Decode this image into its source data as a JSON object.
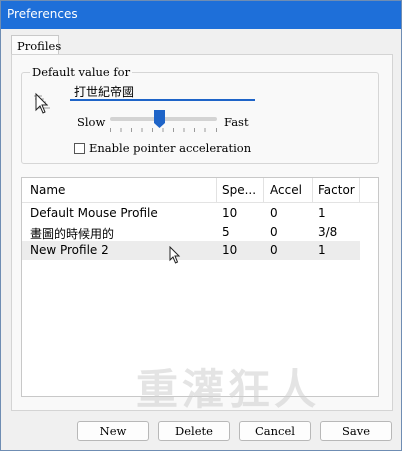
{
  "window": {
    "title": "Preferences"
  },
  "tabs": [
    {
      "label": "Profiles"
    }
  ],
  "default_group": {
    "legend": "Default value for",
    "profile_name": "打世紀帝國",
    "speed_slow_label": "Slow",
    "speed_fast_label": "Fast",
    "acceleration_label": "Enable pointer acceleration",
    "acceleration_checked": false
  },
  "profile_list": {
    "columns": [
      "Name",
      "Spe...",
      "Accel",
      "Factor"
    ],
    "rows": [
      {
        "name": "Default Mouse Profile",
        "speed": "10",
        "accel": "0",
        "factor": "1"
      },
      {
        "name": "畫圖的時候用的",
        "speed": "5",
        "accel": "0",
        "factor": "3/8"
      },
      {
        "name": "New Profile 2",
        "speed": "10",
        "accel": "0",
        "factor": "1",
        "selected": true
      }
    ]
  },
  "buttons": {
    "new": "New",
    "delete": "Delete",
    "cancel": "Cancel",
    "save": "Save"
  },
  "watermark": "重灌狂人",
  "colors": {
    "titlebar": "#1e6fd9",
    "accent": "#1e64c8"
  }
}
